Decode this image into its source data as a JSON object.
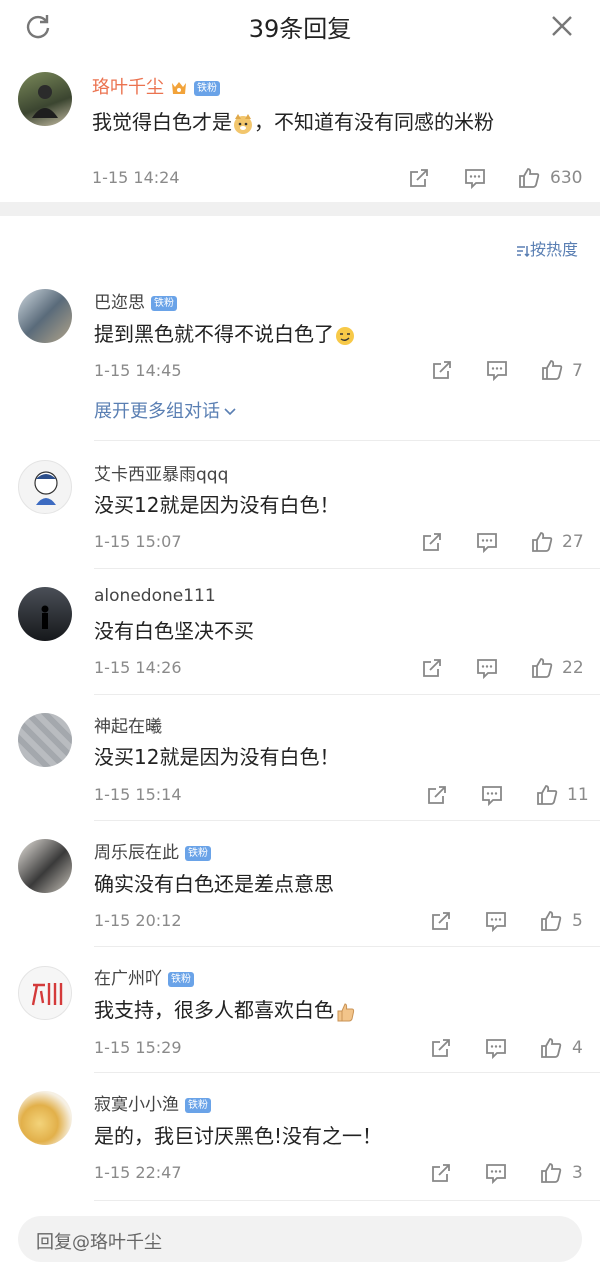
{
  "header": {
    "title": "39条回复",
    "refresh_icon": "refresh-icon",
    "close_icon": "close-icon"
  },
  "top_comment": {
    "user": "珞叶千尘",
    "badge": "铁粉",
    "text_before": "我觉得白色才是",
    "text_after": "，不知道有没有同感的米粉",
    "time": "1-15 14:24",
    "likes": "630"
  },
  "sort_label": "按热度",
  "expand_label": "展开更多组对话",
  "replies": [
    {
      "user": "巴迩思",
      "badge": "铁粉",
      "text": "提到黑色就不得不说白色了",
      "emoji": "smirk",
      "time": "1-15 14:45",
      "likes": "7"
    },
    {
      "user": "艾卡西亚暴雨qqq",
      "badge": "",
      "text": "没买12就是因为没有白色！",
      "emoji": "",
      "time": "1-15 15:07",
      "likes": "27"
    },
    {
      "user": "alonedone111",
      "badge": "",
      "text": "没有白色坚决不买",
      "emoji": "",
      "time": "1-15 14:26",
      "likes": "22"
    },
    {
      "user": "神起在曦",
      "badge": "",
      "text": "没买12就是因为没有白色！",
      "emoji": "",
      "time": "1-15 15:14",
      "likes": "11"
    },
    {
      "user": "周乐辰在此",
      "badge": "铁粉",
      "text": "确实没有白色还是差点意思",
      "emoji": "",
      "time": "1-15 20:12",
      "likes": "5"
    },
    {
      "user": "在广州吖",
      "badge": "铁粉",
      "text": "我支持，很多人都喜欢白色",
      "emoji": "thumb",
      "time": "1-15 15:29",
      "likes": "4"
    },
    {
      "user": "寂寞小小渔",
      "badge": "铁粉",
      "text": "是的，我巨讨厌黑色!没有之一！",
      "emoji": "",
      "time": "1-15 22:47",
      "likes": "3"
    }
  ],
  "input": {
    "placeholder": "回复@珞叶千尘"
  },
  "colors": {
    "accent_blue": "#5a7fb3",
    "username_orange": "#eb7350",
    "badge_blue": "#6aa3e8"
  }
}
